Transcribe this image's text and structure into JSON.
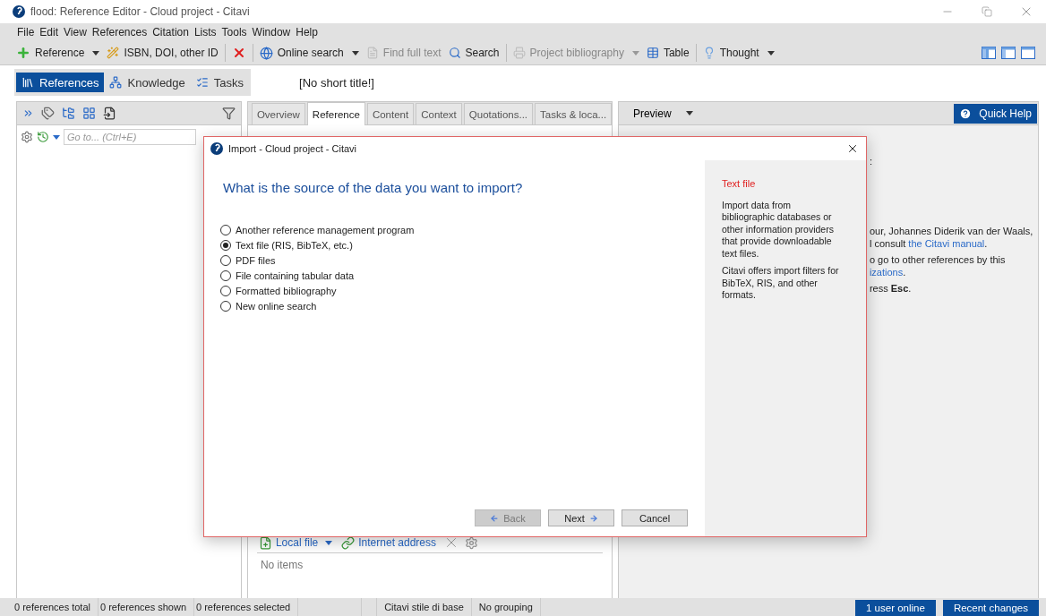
{
  "window": {
    "title": "flood: Reference Editor - Cloud project - Citavi"
  },
  "menu": [
    "File",
    "Edit",
    "View",
    "References",
    "Citation",
    "Lists",
    "Tools",
    "Window",
    "Help"
  ],
  "toolbar": [
    {
      "kind": "button",
      "label": "Reference",
      "has_menu": true,
      "disabled": false
    },
    {
      "kind": "button",
      "label": "ISBN, DOI, other ID",
      "has_menu": false,
      "disabled": false
    },
    {
      "kind": "separator"
    },
    {
      "kind": "icon",
      "disabled": false
    },
    {
      "kind": "separator"
    },
    {
      "kind": "button",
      "label": "Online search",
      "has_menu": true,
      "disabled": false
    },
    {
      "kind": "button",
      "label": "Find full text",
      "has_menu": false,
      "disabled": true
    },
    {
      "kind": "button",
      "label": "Search",
      "has_menu": false,
      "disabled": false
    },
    {
      "kind": "separator"
    },
    {
      "kind": "button",
      "label": "Project bibliography",
      "has_menu": true,
      "disabled": true
    },
    {
      "kind": "button",
      "label": "Table",
      "has_menu": false,
      "disabled": false
    },
    {
      "kind": "separator"
    },
    {
      "kind": "button",
      "label": "Thought",
      "has_menu": true,
      "disabled": false
    }
  ],
  "nav": [
    {
      "label": "References",
      "selected": true
    },
    {
      "label": "Knowledge",
      "selected": false
    },
    {
      "label": "Tasks",
      "selected": false
    }
  ],
  "short_title": "[No short title!]",
  "left_panel": {
    "goto": {
      "placeholder": "Go to... (Ctrl+E)"
    }
  },
  "editor": {
    "tabs": [
      {
        "label": "Overview",
        "selected": false
      },
      {
        "label": "Reference",
        "selected": true
      },
      {
        "label": "Content",
        "selected": false
      },
      {
        "label": "Context",
        "selected": false
      },
      {
        "label": "Quotations...",
        "selected": false
      },
      {
        "label": "Tasks & loca...",
        "selected": false
      }
    ],
    "attachments": {
      "buttons": [
        "Local file",
        "Internet address"
      ],
      "empty": "No items"
    }
  },
  "preview": {
    "label": "Preview",
    "quick_help": "Quick Help",
    "paragraphs": [
      [
        {
          "text": ":"
        }
      ],
      [
        {
          "text": "our, Johannes Diderik van der Waals,"
        },
        {
          "text": "l consult ",
          "link": "the Citavi manual",
          "after": "."
        }
      ],
      [
        {
          "text": "o go to other references by this"
        },
        {
          "link": "izations",
          "after": "."
        }
      ],
      [
        {
          "text": "ress **Esc**."
        }
      ]
    ]
  },
  "dialog": {
    "title": "Import - Cloud project - Citavi",
    "question": "What is the source of the data you want to import?",
    "options": [
      {
        "label": "Another reference management program",
        "selected": false
      },
      {
        "label": "Text file (RIS, BibTeX, etc.)",
        "selected": true
      },
      {
        "label": "PDF files",
        "selected": false
      },
      {
        "label": "File containing tabular data",
        "selected": false
      },
      {
        "label": "Formatted bibliography",
        "selected": false
      },
      {
        "label": "New online search",
        "selected": false
      }
    ],
    "help": {
      "heading": "Text file",
      "paragraphs": [
        "Import data from bibliographic databases or other information providers that provide downloadable text files.",
        "Citavi offers import filters for BibTeX, RIS, and other formats."
      ]
    },
    "buttons": [
      {
        "label": "Back",
        "disabled": true
      },
      {
        "label": "Next",
        "disabled": false
      },
      {
        "label": "Cancel",
        "disabled": false
      }
    ]
  },
  "status_bar": {
    "left": [
      "0 references total",
      "0 references shown",
      "0 references selected"
    ],
    "middle": [
      "Citavi stile di base",
      "No grouping"
    ],
    "right": [
      "1 user online",
      "Recent changes"
    ]
  }
}
